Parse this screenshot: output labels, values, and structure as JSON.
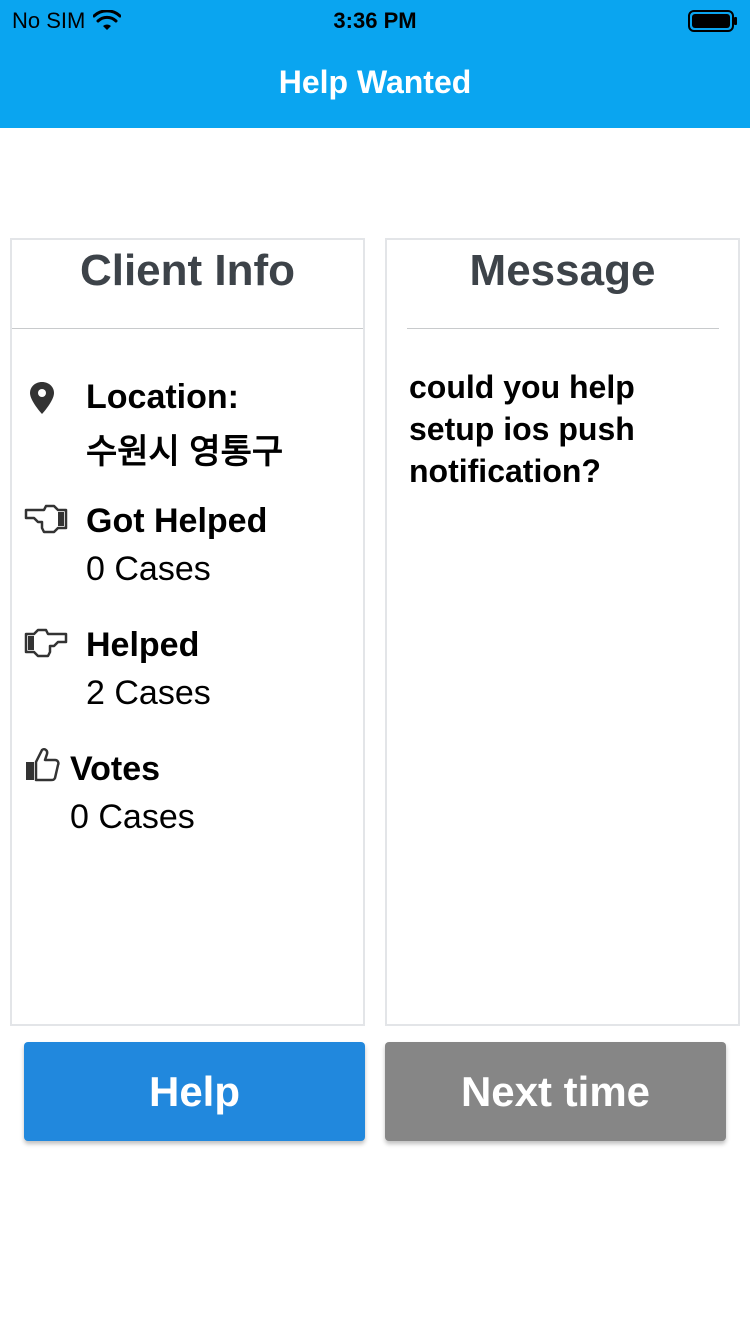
{
  "status_bar": {
    "carrier": "No SIM",
    "time": "3:36 PM",
    "icons": [
      "wifi-icon",
      "battery-icon"
    ]
  },
  "header": {
    "title": "Help Wanted",
    "color": "#0aa5f0"
  },
  "client_info": {
    "title": "Client Info",
    "location_label": "Location:",
    "location_value": "수원시 영통구",
    "got_helped_label": "Got Helped",
    "got_helped_value": "0 Cases",
    "helped_label": "Helped",
    "helped_value": "2 Cases",
    "votes_label": "Votes",
    "votes_value": "0 Cases",
    "icons": [
      "map-marker-icon",
      "hand-point-left-icon",
      "hand-point-right-icon",
      "thumbs-up-icon"
    ]
  },
  "message": {
    "title": "Message",
    "text": "could you help setup ios push notification?"
  },
  "buttons": {
    "help_label": "Help",
    "next_time_label": "Next time",
    "help_color": "#2188dd",
    "next_time_color": "#868686"
  }
}
